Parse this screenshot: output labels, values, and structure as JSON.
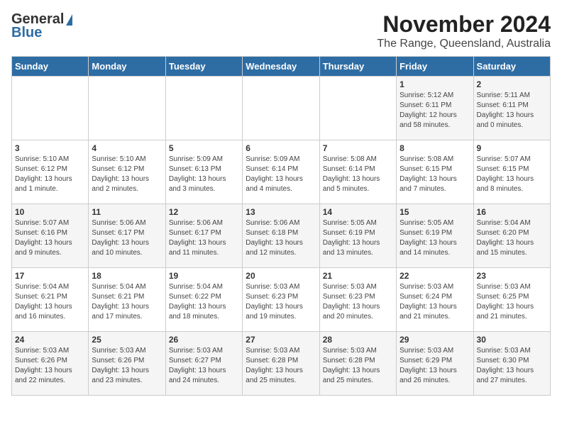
{
  "logo": {
    "general": "General",
    "blue": "Blue"
  },
  "title": "November 2024",
  "subtitle": "The Range, Queensland, Australia",
  "headers": [
    "Sunday",
    "Monday",
    "Tuesday",
    "Wednesday",
    "Thursday",
    "Friday",
    "Saturday"
  ],
  "weeks": [
    [
      {
        "day": "",
        "detail": ""
      },
      {
        "day": "",
        "detail": ""
      },
      {
        "day": "",
        "detail": ""
      },
      {
        "day": "",
        "detail": ""
      },
      {
        "day": "",
        "detail": ""
      },
      {
        "day": "1",
        "detail": "Sunrise: 5:12 AM\nSunset: 6:11 PM\nDaylight: 12 hours\nand 58 minutes."
      },
      {
        "day": "2",
        "detail": "Sunrise: 5:11 AM\nSunset: 6:11 PM\nDaylight: 13 hours\nand 0 minutes."
      }
    ],
    [
      {
        "day": "3",
        "detail": "Sunrise: 5:10 AM\nSunset: 6:12 PM\nDaylight: 13 hours\nand 1 minute."
      },
      {
        "day": "4",
        "detail": "Sunrise: 5:10 AM\nSunset: 6:12 PM\nDaylight: 13 hours\nand 2 minutes."
      },
      {
        "day": "5",
        "detail": "Sunrise: 5:09 AM\nSunset: 6:13 PM\nDaylight: 13 hours\nand 3 minutes."
      },
      {
        "day": "6",
        "detail": "Sunrise: 5:09 AM\nSunset: 6:14 PM\nDaylight: 13 hours\nand 4 minutes."
      },
      {
        "day": "7",
        "detail": "Sunrise: 5:08 AM\nSunset: 6:14 PM\nDaylight: 13 hours\nand 5 minutes."
      },
      {
        "day": "8",
        "detail": "Sunrise: 5:08 AM\nSunset: 6:15 PM\nDaylight: 13 hours\nand 7 minutes."
      },
      {
        "day": "9",
        "detail": "Sunrise: 5:07 AM\nSunset: 6:15 PM\nDaylight: 13 hours\nand 8 minutes."
      }
    ],
    [
      {
        "day": "10",
        "detail": "Sunrise: 5:07 AM\nSunset: 6:16 PM\nDaylight: 13 hours\nand 9 minutes."
      },
      {
        "day": "11",
        "detail": "Sunrise: 5:06 AM\nSunset: 6:17 PM\nDaylight: 13 hours\nand 10 minutes."
      },
      {
        "day": "12",
        "detail": "Sunrise: 5:06 AM\nSunset: 6:17 PM\nDaylight: 13 hours\nand 11 minutes."
      },
      {
        "day": "13",
        "detail": "Sunrise: 5:06 AM\nSunset: 6:18 PM\nDaylight: 13 hours\nand 12 minutes."
      },
      {
        "day": "14",
        "detail": "Sunrise: 5:05 AM\nSunset: 6:19 PM\nDaylight: 13 hours\nand 13 minutes."
      },
      {
        "day": "15",
        "detail": "Sunrise: 5:05 AM\nSunset: 6:19 PM\nDaylight: 13 hours\nand 14 minutes."
      },
      {
        "day": "16",
        "detail": "Sunrise: 5:04 AM\nSunset: 6:20 PM\nDaylight: 13 hours\nand 15 minutes."
      }
    ],
    [
      {
        "day": "17",
        "detail": "Sunrise: 5:04 AM\nSunset: 6:21 PM\nDaylight: 13 hours\nand 16 minutes."
      },
      {
        "day": "18",
        "detail": "Sunrise: 5:04 AM\nSunset: 6:21 PM\nDaylight: 13 hours\nand 17 minutes."
      },
      {
        "day": "19",
        "detail": "Sunrise: 5:04 AM\nSunset: 6:22 PM\nDaylight: 13 hours\nand 18 minutes."
      },
      {
        "day": "20",
        "detail": "Sunrise: 5:03 AM\nSunset: 6:23 PM\nDaylight: 13 hours\nand 19 minutes."
      },
      {
        "day": "21",
        "detail": "Sunrise: 5:03 AM\nSunset: 6:23 PM\nDaylight: 13 hours\nand 20 minutes."
      },
      {
        "day": "22",
        "detail": "Sunrise: 5:03 AM\nSunset: 6:24 PM\nDaylight: 13 hours\nand 21 minutes."
      },
      {
        "day": "23",
        "detail": "Sunrise: 5:03 AM\nSunset: 6:25 PM\nDaylight: 13 hours\nand 21 minutes."
      }
    ],
    [
      {
        "day": "24",
        "detail": "Sunrise: 5:03 AM\nSunset: 6:26 PM\nDaylight: 13 hours\nand 22 minutes."
      },
      {
        "day": "25",
        "detail": "Sunrise: 5:03 AM\nSunset: 6:26 PM\nDaylight: 13 hours\nand 23 minutes."
      },
      {
        "day": "26",
        "detail": "Sunrise: 5:03 AM\nSunset: 6:27 PM\nDaylight: 13 hours\nand 24 minutes."
      },
      {
        "day": "27",
        "detail": "Sunrise: 5:03 AM\nSunset: 6:28 PM\nDaylight: 13 hours\nand 25 minutes."
      },
      {
        "day": "28",
        "detail": "Sunrise: 5:03 AM\nSunset: 6:28 PM\nDaylight: 13 hours\nand 25 minutes."
      },
      {
        "day": "29",
        "detail": "Sunrise: 5:03 AM\nSunset: 6:29 PM\nDaylight: 13 hours\nand 26 minutes."
      },
      {
        "day": "30",
        "detail": "Sunrise: 5:03 AM\nSunset: 6:30 PM\nDaylight: 13 hours\nand 27 minutes."
      }
    ]
  ]
}
